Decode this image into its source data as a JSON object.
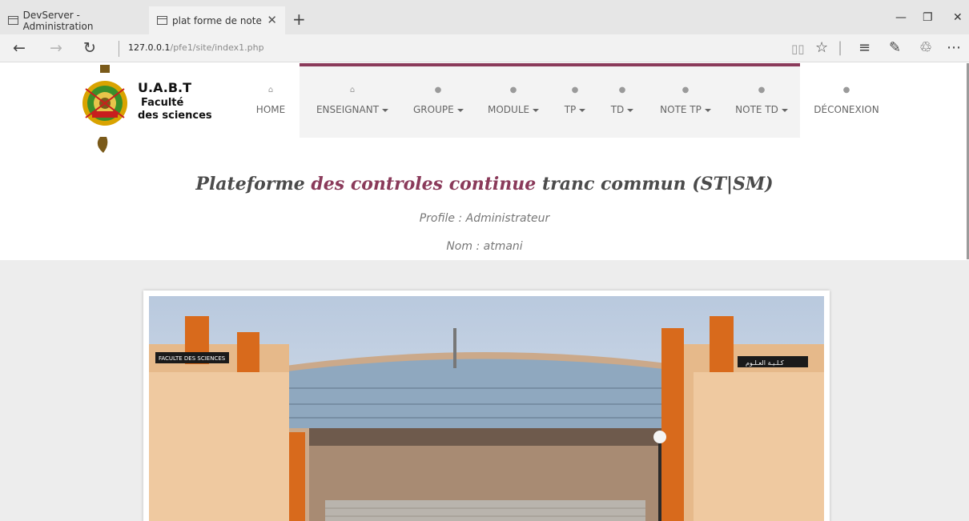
{
  "browser": {
    "tabs": [
      {
        "title": "DevServer - Administration",
        "active": false
      },
      {
        "title": "plat forme de note",
        "active": true
      }
    ],
    "url_host": "127.0.0.1",
    "url_path": "/pfe1/site/index1.php"
  },
  "logo": {
    "line1": "U.A.B.T",
    "line2": "Faculté",
    "line3": "des sciences"
  },
  "nav": {
    "home": "HOME",
    "enseignant": "ENSEIGNANT",
    "groupe": "GROUPE",
    "module": "MODULE",
    "tp": "TP",
    "td": "TD",
    "note_tp": "NOTE TP",
    "note_td": "NOTE TD",
    "deconexion": "DÉCONEXION"
  },
  "headline": {
    "part1": "Plateforme ",
    "accent": "des controles continue",
    "part2": " tranc commun (ST|SM)"
  },
  "profile_text": "Profile : Administrateur",
  "name_text": "Nom : atmani",
  "photo": {
    "sign_left": "FACULTE DES SCIENCES",
    "sign_right": "كـلـيـة العـلـوم"
  },
  "colors": {
    "accent": "#8a3a5a",
    "nav_band": "#f3f3f3"
  }
}
